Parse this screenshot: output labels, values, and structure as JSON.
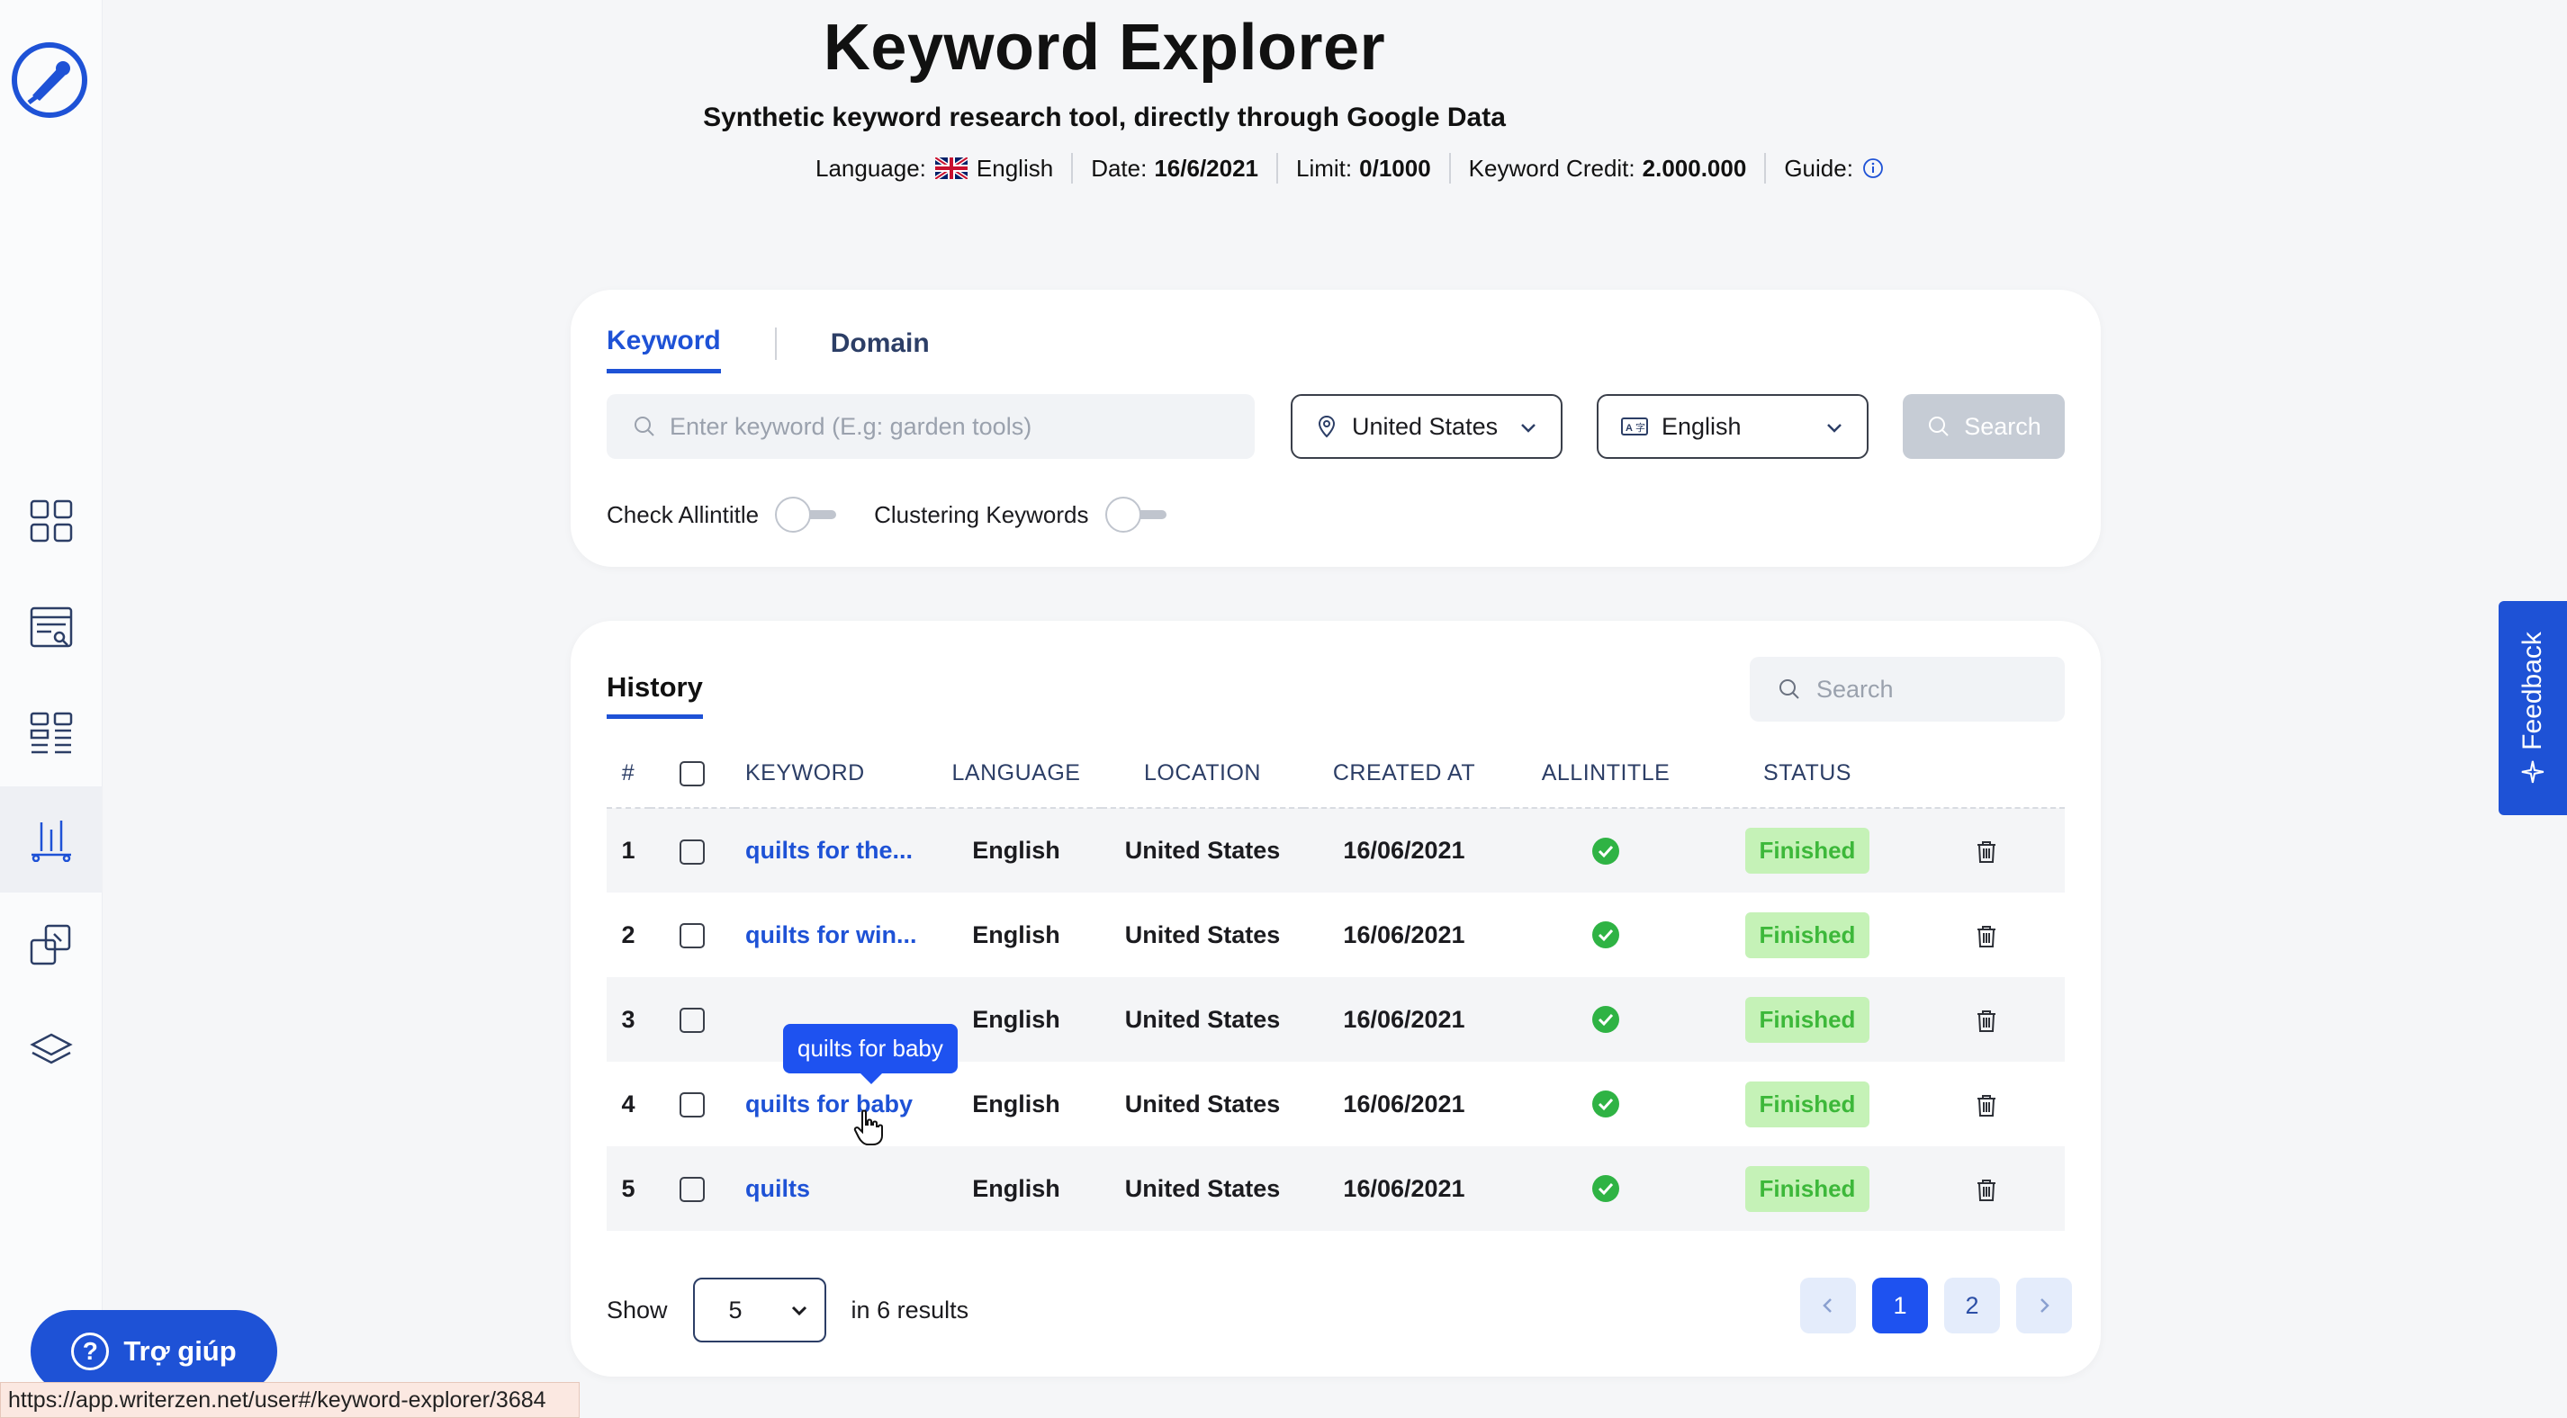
{
  "header": {
    "title": "Keyword Explorer",
    "subtitle": "Synthetic keyword research tool, directly through Google Data",
    "language_label": "Language:",
    "language_value": "English",
    "date_label": "Date:",
    "date_value": "16/6/2021",
    "limit_label": "Limit:",
    "limit_value": "0/1000",
    "credit_label": "Keyword Credit:",
    "credit_value": "2.000.000",
    "guide_label": "Guide:"
  },
  "search_card": {
    "tabs": [
      "Keyword",
      "Domain"
    ],
    "active_tab": "Keyword",
    "keyword_placeholder": "Enter keyword (E.g: garden tools)",
    "location_value": "United States",
    "language_value": "English",
    "search_label": "Search",
    "check_allintitle_label": "Check Allintitle",
    "check_allintitle_on": false,
    "clustering_label": "Clustering Keywords",
    "clustering_on": false
  },
  "history": {
    "title": "History",
    "search_placeholder": "Search",
    "columns": [
      "#",
      "",
      "KEYWORD",
      "LANGUAGE",
      "LOCATION",
      "CREATED AT",
      "ALLINTITLE",
      "STATUS",
      ""
    ],
    "rows": [
      {
        "num": "1",
        "keyword": "quilts for the...",
        "language": "English",
        "location": "United States",
        "created_at": "16/06/2021",
        "status": "Finished"
      },
      {
        "num": "2",
        "keyword": "quilts for win...",
        "language": "English",
        "location": "United States",
        "created_at": "16/06/2021",
        "status": "Finished"
      },
      {
        "num": "3",
        "keyword": "",
        "language": "English",
        "location": "United States",
        "created_at": "16/06/2021",
        "status": "Finished"
      },
      {
        "num": "4",
        "keyword": "quilts for baby",
        "language": "English",
        "location": "United States",
        "created_at": "16/06/2021",
        "status": "Finished"
      },
      {
        "num": "5",
        "keyword": "quilts",
        "language": "English",
        "location": "United States",
        "created_at": "16/06/2021",
        "status": "Finished"
      }
    ],
    "tooltip": "quilts for baby",
    "show_label": "Show",
    "page_size": "5",
    "results_label": "in 6 results",
    "pages": [
      "1",
      "2"
    ],
    "current_page": "1"
  },
  "feedback_label": "Feedback",
  "help_label": "Trợ giúp",
  "status_url": "https://app.writerzen.net/user#/keyword-explorer/3684",
  "colors": {
    "accent": "#1e52d6",
    "status_bg": "#c5f2b7",
    "status_text": "#3db83a"
  }
}
